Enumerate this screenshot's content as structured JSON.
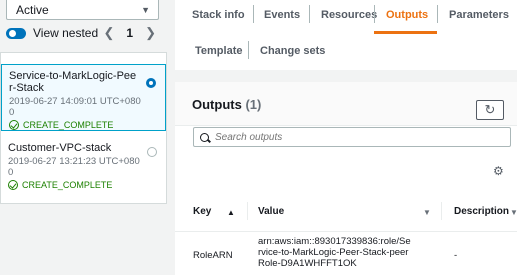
{
  "left": {
    "filter_value": "Active",
    "view_nested_label": "View nested",
    "page": "1",
    "stacks": [
      {
        "name": "Service-to-MarkLogic-Peer-Stack",
        "date": "2019-06-27 14:09:01 UTC+0800",
        "status": "CREATE_COMPLETE",
        "selected": true
      },
      {
        "name": "Customer-VPC-stack",
        "date": "2019-06-27 13:21:23 UTC+0800",
        "status": "CREATE_COMPLETE",
        "selected": false
      }
    ]
  },
  "tabs": {
    "stack_info": "Stack info",
    "events": "Events",
    "resources": "Resources",
    "outputs": "Outputs",
    "parameters": "Parameters",
    "template": "Template",
    "change_sets": "Change sets"
  },
  "outputs": {
    "title": "Outputs",
    "count": "(1)",
    "search_placeholder": "Search outputs",
    "columns": {
      "key": "Key",
      "value": "Value",
      "description": "Description"
    },
    "rows": [
      {
        "key": "RoleARN",
        "value": "arn:aws:iam::893017339836:role/Service-to-MarkLogic-Peer-Stack-peerRole-D9A1WHFFT1OK",
        "description": "-"
      }
    ]
  },
  "colors": {
    "accent": "#ec7211",
    "link": "#0073bb",
    "success": "#1d8102"
  }
}
